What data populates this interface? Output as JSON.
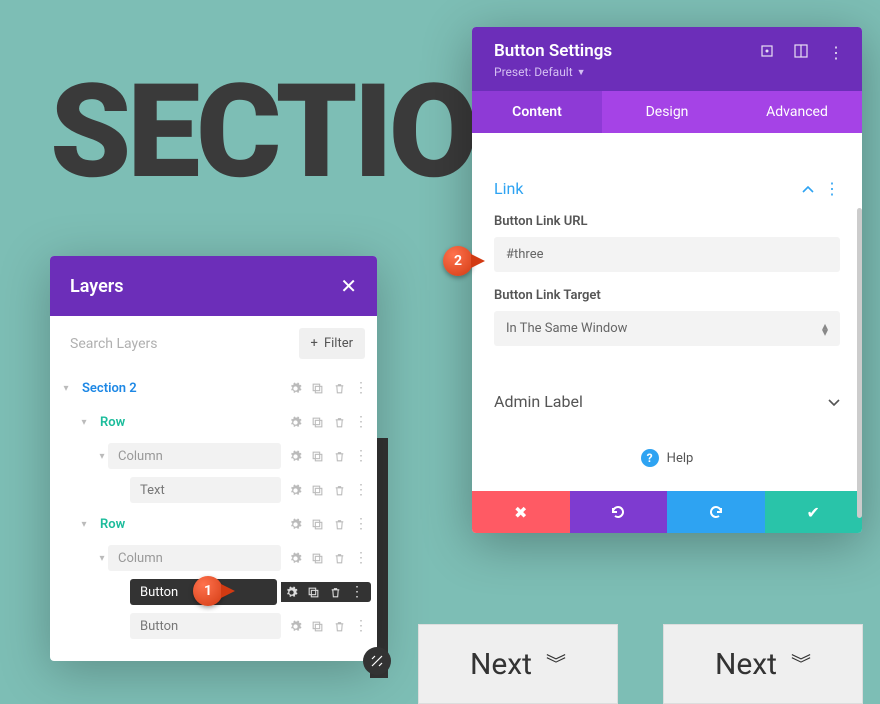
{
  "bg_title": "SECTIO",
  "layers": {
    "title": "Layers",
    "search_placeholder": "Search Layers",
    "filter_label": "Filter",
    "tree": [
      {
        "label": "Section 2",
        "type": "section",
        "indent": 0,
        "expanded": true
      },
      {
        "label": "Row",
        "type": "row",
        "indent": 1,
        "expanded": true
      },
      {
        "label": "Column",
        "type": "column",
        "indent": 2,
        "expanded": true
      },
      {
        "label": "Text",
        "type": "module",
        "indent": 3
      },
      {
        "label": "Row",
        "type": "row",
        "indent": 1,
        "expanded": true
      },
      {
        "label": "Column",
        "type": "column",
        "indent": 2,
        "expanded": true
      },
      {
        "label": "Button",
        "type": "module",
        "indent": 3,
        "selected": true
      },
      {
        "label": "Button",
        "type": "module",
        "indent": 3
      }
    ]
  },
  "settings": {
    "title": "Button Settings",
    "preset_label": "Preset: Default",
    "tabs": {
      "content": "Content",
      "design": "Design",
      "advanced": "Advanced"
    },
    "active_tab": "content",
    "link": {
      "section_title": "Link",
      "url_label": "Button Link URL",
      "url_value": "#three",
      "target_label": "Button Link Target",
      "target_value": "In The Same Window"
    },
    "admin_label": {
      "section_title": "Admin Label"
    },
    "help_label": "Help"
  },
  "callouts": {
    "c1": "1",
    "c2": "2"
  },
  "next_buttons": {
    "label": "Next"
  }
}
